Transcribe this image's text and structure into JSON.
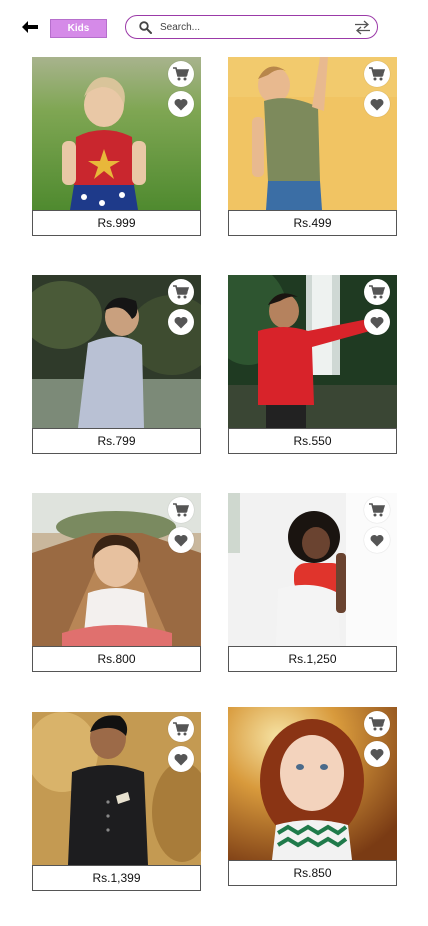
{
  "header": {
    "back_icon": "arrow-left-icon",
    "category_label": "Kids",
    "search_placeholder": "Search...",
    "search_icon": "search-icon",
    "swap_icon": "swap-arrows-icon"
  },
  "colors": {
    "accent": "#d58ae8",
    "search_border": "#9b3aa8"
  },
  "products": [
    {
      "price": "Rs.999",
      "cart_icon": "cart-icon",
      "fav_icon": "heart-icon"
    },
    {
      "price": "Rs.499",
      "cart_icon": "cart-icon",
      "fav_icon": "heart-icon"
    },
    {
      "price": "Rs.799",
      "cart_icon": "cart-icon",
      "fav_icon": "heart-icon"
    },
    {
      "price": "Rs.550",
      "cart_icon": "cart-icon",
      "fav_icon": "heart-icon"
    },
    {
      "price": "Rs.800",
      "cart_icon": "cart-icon",
      "fav_icon": "heart-icon"
    },
    {
      "price": "Rs.1,250",
      "cart_icon": "cart-icon",
      "fav_icon": "heart-icon"
    },
    {
      "price": "Rs.1,399",
      "cart_icon": "cart-icon",
      "fav_icon": "heart-icon"
    },
    {
      "price": "Rs.850",
      "cart_icon": "cart-icon",
      "fav_icon": "heart-icon"
    }
  ]
}
